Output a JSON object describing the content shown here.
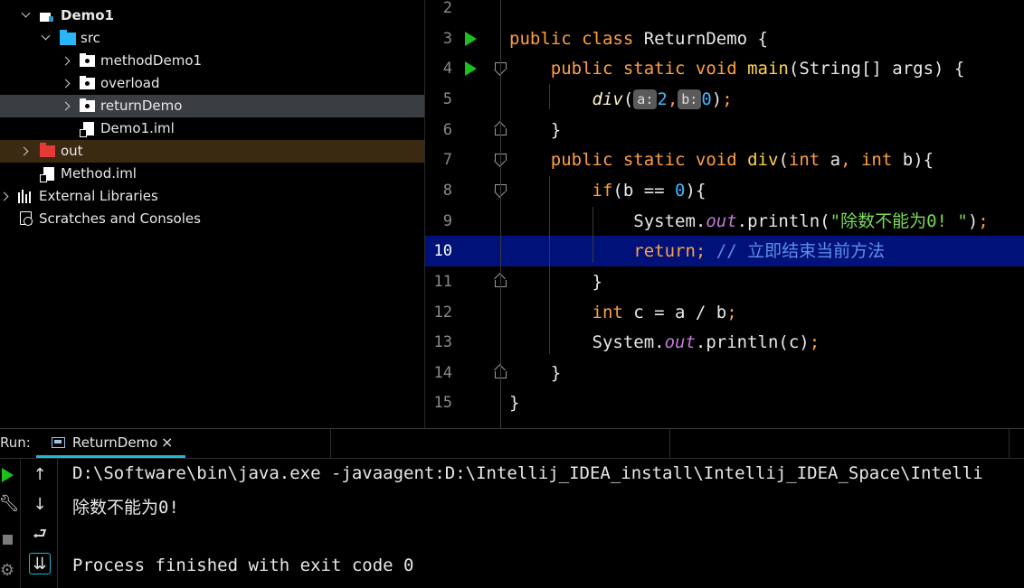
{
  "project_tree": [
    {
      "label": "Demo1",
      "bold": true,
      "indent": 0,
      "expand": "down",
      "icon": "module-icon"
    },
    {
      "label": "src",
      "indent": 1,
      "expand": "down",
      "icon": "source-folder-icon"
    },
    {
      "label": "methodDemo1",
      "indent": 2,
      "expand": "right",
      "icon": "package-icon"
    },
    {
      "label": "overload",
      "indent": 2,
      "expand": "right",
      "icon": "package-icon"
    },
    {
      "label": "returnDemo",
      "indent": 2,
      "expand": "right",
      "icon": "package-icon",
      "selected": true
    },
    {
      "label": "Demo1.iml",
      "indent": 2,
      "expand": "none",
      "icon": "iml-file-icon"
    },
    {
      "label": "out",
      "indent": 0,
      "expand": "right",
      "icon": "excluded-folder-icon",
      "excluded": true
    },
    {
      "label": "Method.iml",
      "indent": 0,
      "expand": "none",
      "icon": "iml-file-icon"
    },
    {
      "label": "External Libraries",
      "indent": -1,
      "expand": "right",
      "icon": "library-icon"
    },
    {
      "label": "Scratches and Consoles",
      "indent": -1,
      "expand": "none",
      "icon": "scratch-icon"
    }
  ],
  "editor": {
    "current_line": "10",
    "lines": [
      {
        "n": "2",
        "tokens": []
      },
      {
        "n": "3",
        "run": true,
        "tokens": [
          [
            "kw",
            "public class "
          ],
          [
            "p",
            "ReturnDemo {"
          ]
        ]
      },
      {
        "n": "4",
        "run": true,
        "fold": "down",
        "tokens": [
          [
            "p",
            "    "
          ],
          [
            "kw",
            "public static void "
          ],
          [
            "fn",
            "main"
          ],
          [
            "p",
            "(String[] args) {"
          ]
        ]
      },
      {
        "n": "5",
        "tokens": [
          [
            "p",
            "        "
          ],
          [
            "fni",
            "div"
          ],
          [
            "p",
            "("
          ],
          [
            "hint",
            "a:"
          ],
          [
            "num",
            "2"
          ],
          [
            "kw",
            ","
          ],
          [
            "hint",
            "b:"
          ],
          [
            "num",
            "0"
          ],
          [
            "p",
            ")"
          ],
          [
            "kw",
            ";"
          ]
        ]
      },
      {
        "n": "6",
        "fold": "up",
        "tokens": [
          [
            "p",
            "    }"
          ]
        ]
      },
      {
        "n": "7",
        "fold": "down",
        "tokens": [
          [
            "p",
            "    "
          ],
          [
            "kw",
            "public static void "
          ],
          [
            "fn",
            "div"
          ],
          [
            "p",
            "("
          ],
          [
            "kw",
            "int "
          ],
          [
            "p",
            "a"
          ],
          [
            "kw",
            ", int "
          ],
          [
            "p",
            "b){"
          ]
        ]
      },
      {
        "n": "8",
        "fold": "down",
        "tokens": [
          [
            "p",
            "        "
          ],
          [
            "kw",
            "if"
          ],
          [
            "p",
            "(b == "
          ],
          [
            "num",
            "0"
          ],
          [
            "p",
            "){"
          ]
        ]
      },
      {
        "n": "9",
        "tokens": [
          [
            "p",
            "            System."
          ],
          [
            "oi",
            "out"
          ],
          [
            "p",
            ".println("
          ],
          [
            "str",
            "\"除数不能为0! \""
          ],
          [
            "p",
            ")"
          ],
          [
            "kw",
            ";"
          ]
        ]
      },
      {
        "n": "10",
        "tokens": [
          [
            "p",
            "            "
          ],
          [
            "kw",
            "return; "
          ],
          [
            "cmt",
            "// 立即结束当前方法"
          ]
        ]
      },
      {
        "n": "11",
        "fold": "up",
        "tokens": [
          [
            "p",
            "        }"
          ]
        ]
      },
      {
        "n": "12",
        "tokens": [
          [
            "p",
            "        "
          ],
          [
            "kw",
            "int "
          ],
          [
            "p",
            "c = a / b"
          ],
          [
            "kw",
            ";"
          ]
        ]
      },
      {
        "n": "13",
        "tokens": [
          [
            "p",
            "        System."
          ],
          [
            "oi",
            "out"
          ],
          [
            "p",
            ".println(c)"
          ],
          [
            "kw",
            ";"
          ]
        ]
      },
      {
        "n": "14",
        "fold": "up",
        "tokens": [
          [
            "p",
            "    }"
          ]
        ]
      },
      {
        "n": "15",
        "tokens": [
          [
            "p",
            "}"
          ]
        ]
      }
    ]
  },
  "run_panel": {
    "label": "Run:",
    "tab_label": "ReturnDemo",
    "tab_close": "×",
    "console_lines": [
      "D:\\Software\\bin\\java.exe -javaagent:D:\\Intellij_IDEA_install\\Intellij_IDEA_Space\\Intelli",
      "除数不能为0!",
      "",
      "Process finished with exit code 0"
    ]
  },
  "colors": {
    "keyword": "#ff9f43",
    "function": "#ffd24a",
    "number": "#3fb8ff",
    "string": "#7dd957",
    "comment": "#5c8fe8",
    "current_line_bg": "#00127a",
    "run_green": "#19c21e",
    "selection_bg": "#3a3d41"
  }
}
